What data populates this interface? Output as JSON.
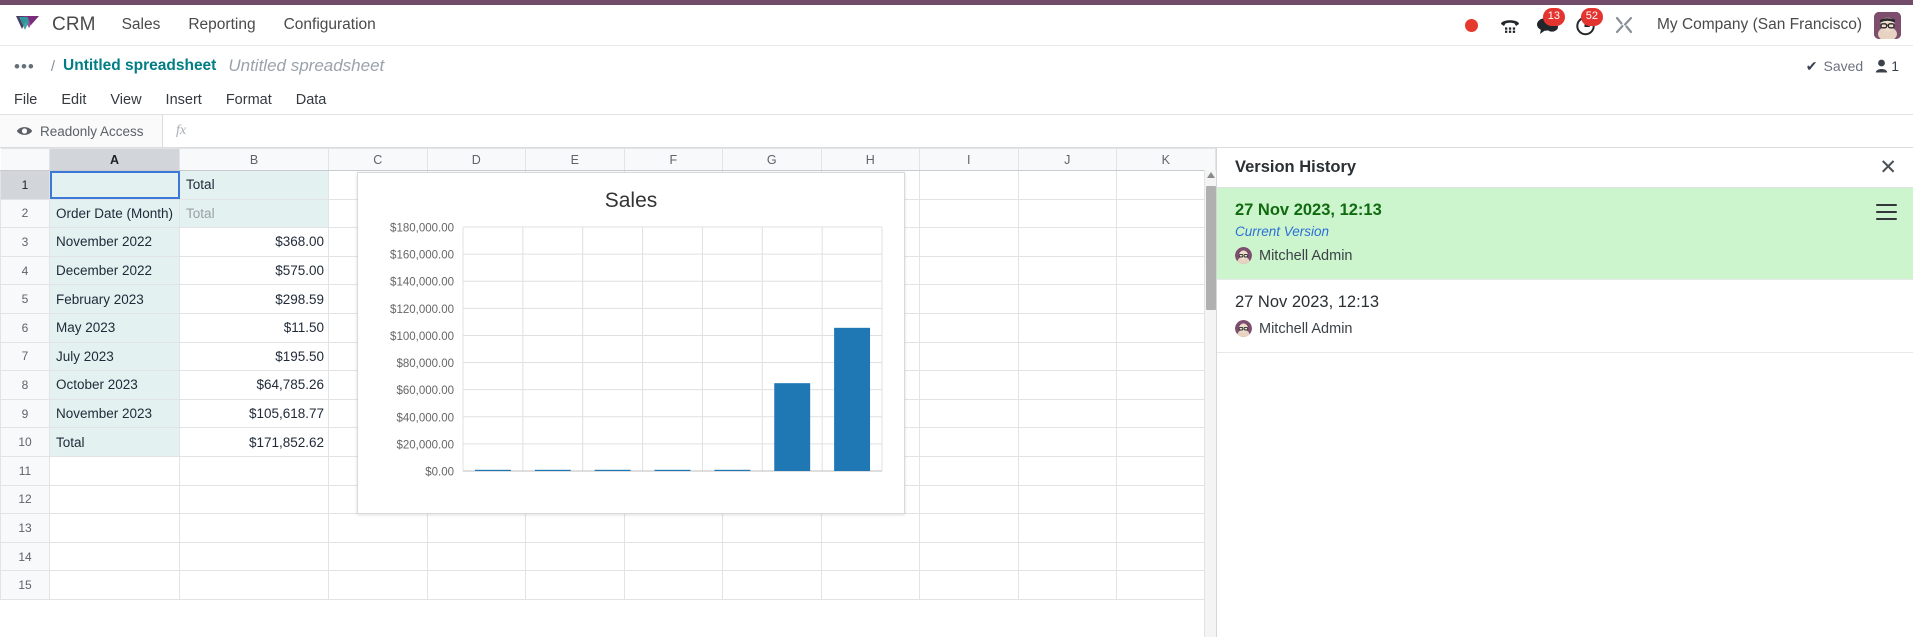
{
  "app": {
    "brand": "CRM",
    "accent_purple": "#714B67",
    "nav": [
      {
        "label": "Sales"
      },
      {
        "label": "Reporting"
      },
      {
        "label": "Configuration"
      }
    ],
    "systray": {
      "record_dot": "record-dot-icon",
      "dialpad": "dialpad-icon",
      "messages": {
        "icon": "chat-bubble-icon",
        "badge": "13"
      },
      "activities": {
        "icon": "clock-icon",
        "badge": "52"
      },
      "debug": "wrench-icon",
      "company": "My Company (San Francisco)",
      "avatar": "user-avatar"
    }
  },
  "breadcrumb": {
    "dots": "•••",
    "separator": "/",
    "link": "Untitled spreadsheet",
    "title": "Untitled spreadsheet",
    "saved_label": "Saved",
    "saved_check": "✔",
    "user_count": "1"
  },
  "menubar": {
    "items": [
      {
        "label": "File"
      },
      {
        "label": "Edit"
      },
      {
        "label": "View"
      },
      {
        "label": "Insert"
      },
      {
        "label": "Format"
      },
      {
        "label": "Data"
      }
    ]
  },
  "toolbar": {
    "readonly_label": "Readonly Access",
    "readonly_icon": "eye-icon",
    "formula_prefix": "fx",
    "formula_value": ""
  },
  "spreadsheet": {
    "columns": [
      "A",
      "B",
      "C",
      "D",
      "E",
      "F",
      "G",
      "H",
      "I",
      "J",
      "K"
    ],
    "rows": [
      "1",
      "2",
      "3",
      "4",
      "5",
      "6",
      "7",
      "8",
      "9",
      "10",
      "11",
      "12",
      "13",
      "14",
      "15"
    ],
    "selected_cell": "A1",
    "cells": [
      {
        "row": "1",
        "a": "",
        "b": "Total"
      },
      {
        "row": "2",
        "a": "Order Date (Month)",
        "b": "Total"
      },
      {
        "row": "3",
        "a": "November 2022",
        "b": "$368.00"
      },
      {
        "row": "4",
        "a": "December 2022",
        "b": "$575.00"
      },
      {
        "row": "5",
        "a": "February 2023",
        "b": "$298.59"
      },
      {
        "row": "6",
        "a": "May 2023",
        "b": "$11.50"
      },
      {
        "row": "7",
        "a": "July 2023",
        "b": "$195.50"
      },
      {
        "row": "8",
        "a": "October 2023",
        "b": "$64,785.26"
      },
      {
        "row": "9",
        "a": "November 2023",
        "b": "$105,618.77"
      },
      {
        "row": "10",
        "a": "Total",
        "b": "$171,852.62"
      },
      {
        "row": "11",
        "a": "",
        "b": ""
      },
      {
        "row": "12",
        "a": "",
        "b": ""
      },
      {
        "row": "13",
        "a": "",
        "b": ""
      },
      {
        "row": "14",
        "a": "",
        "b": ""
      },
      {
        "row": "15",
        "a": "",
        "b": ""
      }
    ]
  },
  "chart_data": {
    "type": "bar",
    "title": "Sales",
    "xlabel": "",
    "ylabel": "",
    "grid": true,
    "legend": false,
    "bar_color": "#1f77b4",
    "categories": [
      "November 2022",
      "December 2022",
      "February 2023",
      "May 2023",
      "July 2023",
      "October 2023",
      "November 2023"
    ],
    "values": [
      368.0,
      575.0,
      298.59,
      11.5,
      195.5,
      64785.26,
      105618.77
    ],
    "ylim": [
      0,
      180000
    ],
    "ytick_labels": [
      "$0.00",
      "$20,000.00",
      "$40,000.00",
      "$60,000.00",
      "$80,000.00",
      "$100,000.00",
      "$120,000.00",
      "$140,000.00",
      "$160,000.00",
      "$180,000.00"
    ],
    "ytick_values": [
      0,
      20000,
      40000,
      60000,
      80000,
      100000,
      120000,
      140000,
      160000,
      180000
    ],
    "series": [
      {
        "name": "Total",
        "values": [
          368.0,
          575.0,
          298.59,
          11.5,
          195.5,
          64785.26,
          105618.77
        ]
      }
    ]
  },
  "version_history": {
    "title": "Version History",
    "close_icon": "close-icon",
    "items": [
      {
        "date": "27 Nov 2023, 12:13",
        "current_label": "Current Version",
        "user": "Mitchell Admin",
        "active": true,
        "has_menu": true
      },
      {
        "date": "27 Nov 2023, 12:13",
        "current_label": "",
        "user": "Mitchell Admin",
        "active": false,
        "has_menu": false
      }
    ]
  }
}
